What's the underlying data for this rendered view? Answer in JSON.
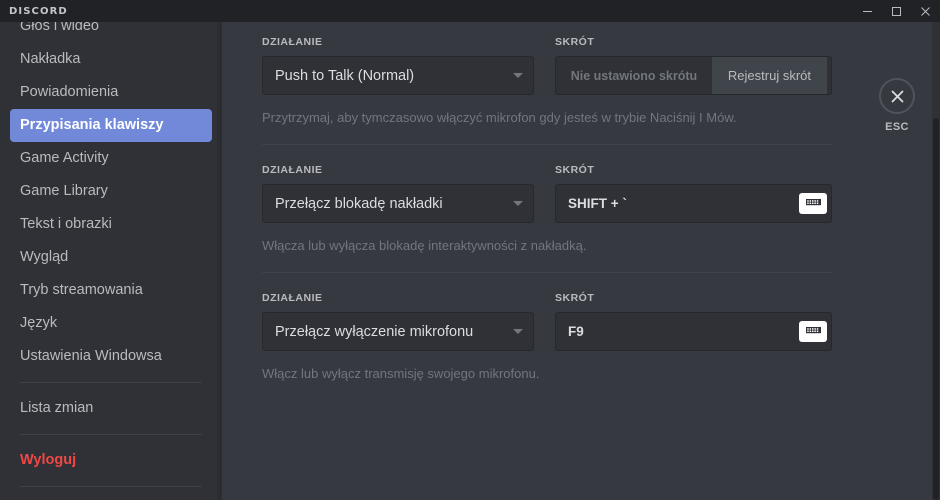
{
  "titlebar": {
    "brand": "DISCORD",
    "minimize_icon": "minimize-icon",
    "maximize_icon": "maximize-icon",
    "close_icon": "close-icon"
  },
  "sidebar": {
    "items": [
      {
        "label": "Głos i wideo",
        "selected": false,
        "danger": false
      },
      {
        "label": "Nakładka",
        "selected": false,
        "danger": false
      },
      {
        "label": "Powiadomienia",
        "selected": false,
        "danger": false
      },
      {
        "label": "Przypisania klawiszy",
        "selected": true,
        "danger": false
      },
      {
        "label": "Game Activity",
        "selected": false,
        "danger": false
      },
      {
        "label": "Game Library",
        "selected": false,
        "danger": false
      },
      {
        "label": "Tekst i obrazki",
        "selected": false,
        "danger": false
      },
      {
        "label": "Wygląd",
        "selected": false,
        "danger": false
      },
      {
        "label": "Tryb streamowania",
        "selected": false,
        "danger": false
      },
      {
        "label": "Język",
        "selected": false,
        "danger": false
      },
      {
        "label": "Ustawienia Windowsa",
        "selected": false,
        "danger": false
      },
      {
        "separator": true
      },
      {
        "label": "Lista zmian",
        "selected": false,
        "danger": false
      },
      {
        "separator": true
      },
      {
        "label": "Wyloguj",
        "selected": false,
        "danger": true
      },
      {
        "separator": true
      }
    ]
  },
  "main": {
    "column_headers": {
      "action": "DZIAŁANIE",
      "shortcut": "SKRÓT"
    },
    "keybinds": [
      {
        "action": "Push to Talk (Normal)",
        "shortcut_value": "",
        "shortcut_placeholder": "Nie ustawiono skrótu",
        "record_label": "Rejestruj skrót",
        "has_keyboard_button": false,
        "description": "Przytrzymaj, aby tymczasowo włączyć mikrofon gdy jesteś w trybie Naciśnij I Mów."
      },
      {
        "action": "Przełącz blokadę nakładki",
        "shortcut_value": "SHIFT + `",
        "shortcut_placeholder": "",
        "record_label": "",
        "has_keyboard_button": true,
        "description": "Włącza lub wyłącza blokadę interaktywności z nakładką."
      },
      {
        "action": "Przełącz wyłączenie mikrofonu",
        "shortcut_value": "F9",
        "shortcut_placeholder": "",
        "record_label": "",
        "has_keyboard_button": true,
        "description": "Włącz lub wyłącz transmisję swojego mikrofonu."
      }
    ]
  },
  "close_panel": {
    "icon": "close-x-icon",
    "label": "ESC"
  },
  "colors": {
    "accent": "#7289da",
    "danger": "#f04747",
    "sidebar_bg": "#2f3136",
    "content_bg": "#36393f",
    "titlebar_bg": "#202225"
  }
}
